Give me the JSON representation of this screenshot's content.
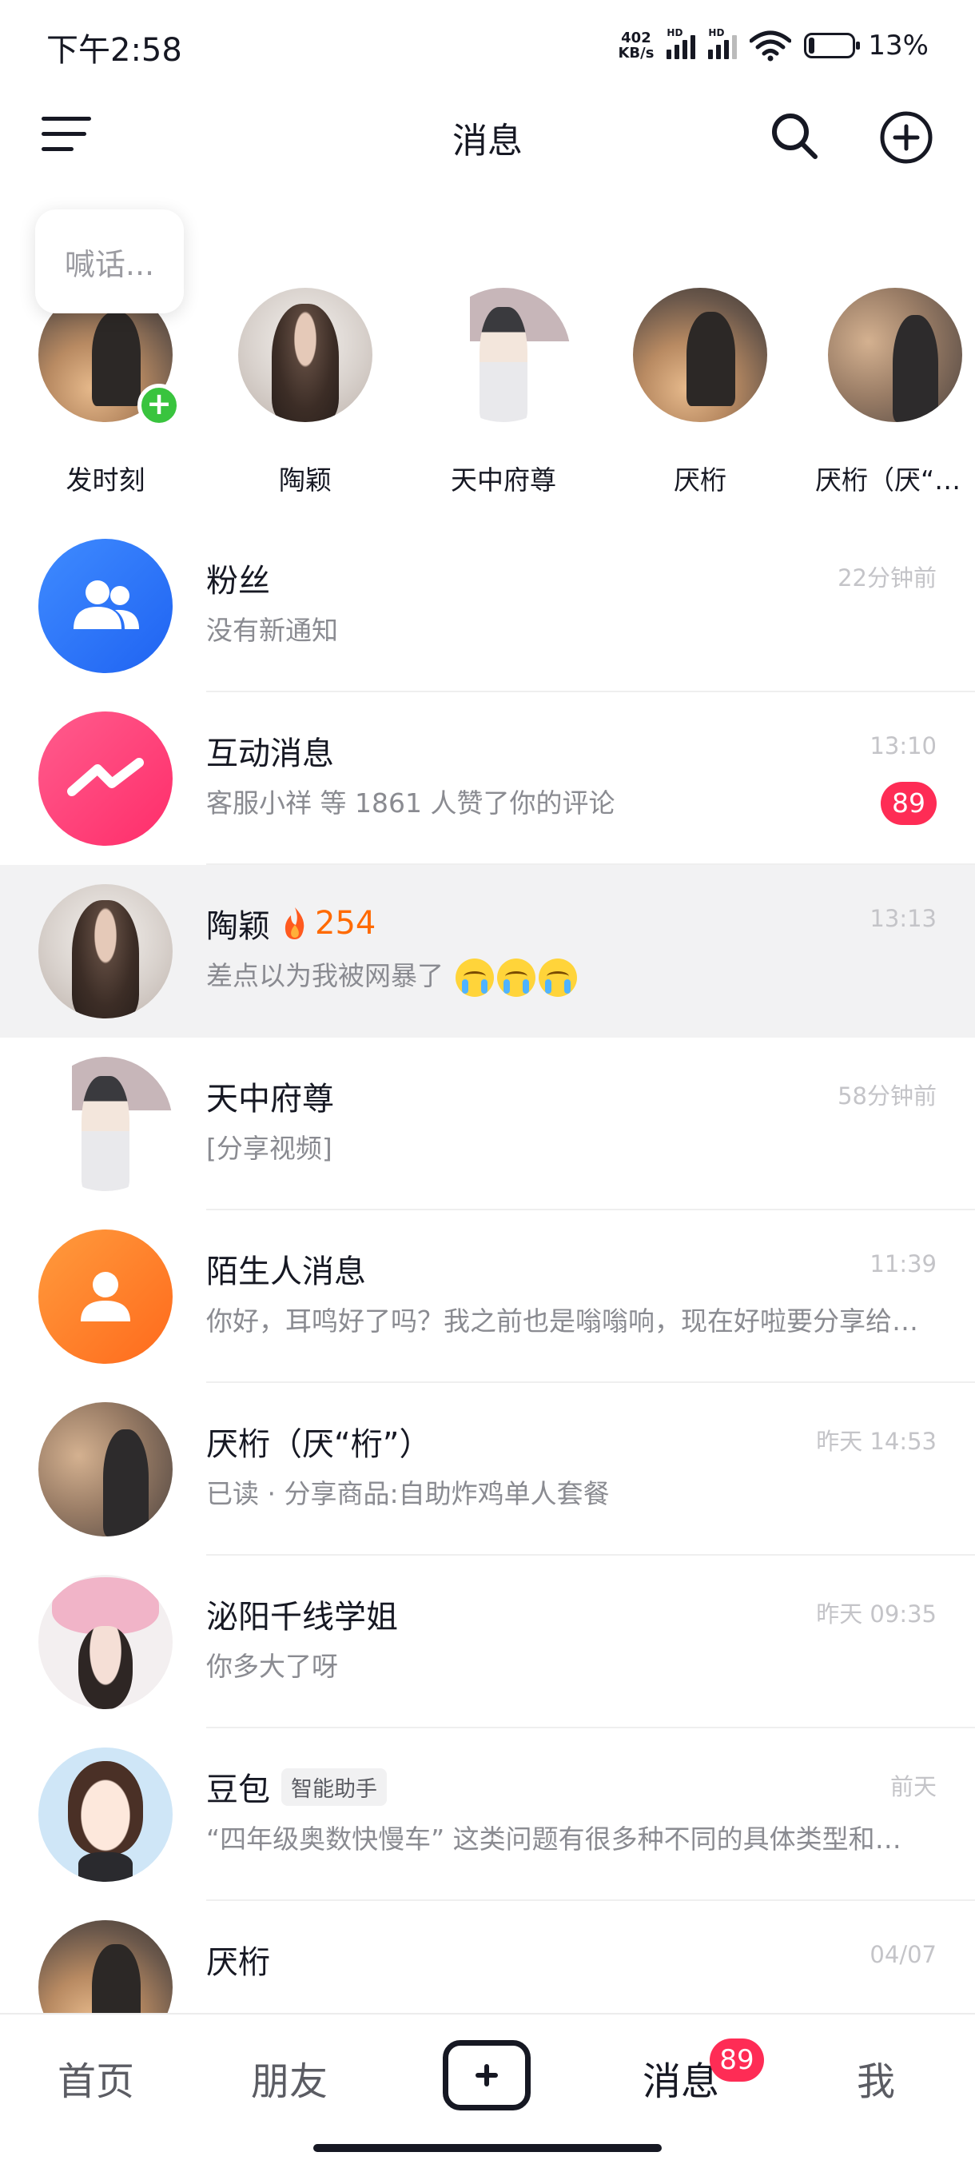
{
  "status_bar": {
    "time": "下午2:58",
    "net_speed_value": "402",
    "net_speed_unit": "KB/s",
    "signal_label": "HD",
    "battery": "13%"
  },
  "header": {
    "title": "消息"
  },
  "stories": {
    "shout_placeholder": "喊话...",
    "items": [
      {
        "name": "发时刻"
      },
      {
        "name": "陶颖"
      },
      {
        "name": "天中府尊"
      },
      {
        "name": "厌桁"
      },
      {
        "name": "厌桁（厌“桁”）"
      }
    ]
  },
  "messages": [
    {
      "title": "粉丝",
      "preview": "没有新通知",
      "time": "22分钟前"
    },
    {
      "title": "互动消息",
      "preview": "客服小祥 等 1861 人赞了你的评论",
      "time": "13:10",
      "unread": "89"
    },
    {
      "title": "陶颖",
      "streak": "254",
      "preview": "差点以为我被网暴了",
      "time": "13:13"
    },
    {
      "title": "天中府尊",
      "preview": "[分享视频]",
      "time": "58分钟前"
    },
    {
      "title": "陌生人消息",
      "preview": "你好，耳鸣好了吗？我之前也是嗡嗡响，现在好啦要分享给你经验",
      "time": "11:39"
    },
    {
      "title": "厌桁（厌“桁”）",
      "preview": "已读 · 分享商品:自助炸鸡单人套餐",
      "time": "昨天 14:53"
    },
    {
      "title": "泌阳千线学姐",
      "preview": "你多大了呀",
      "time": "昨天 09:35"
    },
    {
      "title": "豆包",
      "tag": "智能助手",
      "preview": "“四年级奥数快慢车” 这类问题有很多种不同的具体类型和解法",
      "time": "前天"
    },
    {
      "title": "厌桁",
      "preview": "",
      "time": "04/07"
    }
  ],
  "bottom_nav": {
    "home": "首页",
    "friends": "朋友",
    "messages": "消息",
    "messages_badge": "89",
    "me": "我"
  },
  "colors": {
    "accent_red": "#fe2c55",
    "streak_orange": "#ff6a00",
    "online_green": "#39c43e"
  }
}
